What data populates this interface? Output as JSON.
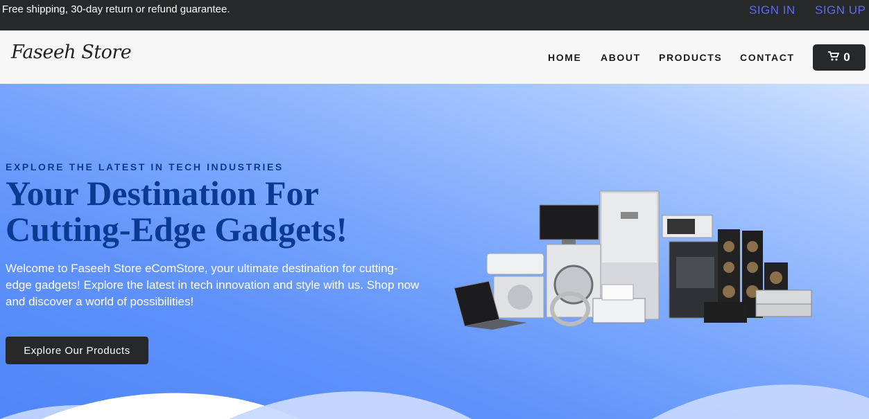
{
  "topbar": {
    "promo": "Free shipping, 30-day return or refund guarantee.",
    "sign_in": "SIGN IN",
    "sign_up": "SIGN UP"
  },
  "navbar": {
    "logo": "Faseeh Store",
    "links": [
      "HOME",
      "ABOUT",
      "PRODUCTS",
      "CONTACT"
    ],
    "cart_count": "0",
    "cart_icon": "shopping-cart-icon"
  },
  "hero": {
    "eyebrow": "EXPLORE THE LATEST IN TECH INDUSTRIES",
    "headline": "Your Destination For Cutting-Edge Gadgets!",
    "description": "Welcome to Faseeh Store eComStore, your ultimate destination for cutting-edge gadgets! Explore the latest in tech innovation and style with us. Shop now and discover a world of possibilities!",
    "cta": "Explore Our Products"
  },
  "colors": {
    "topbar_bg": "#262829",
    "auth_link": "#5b6cf0",
    "headline": "#0b3a93",
    "hero_gradient_end": "#4f85f8"
  }
}
